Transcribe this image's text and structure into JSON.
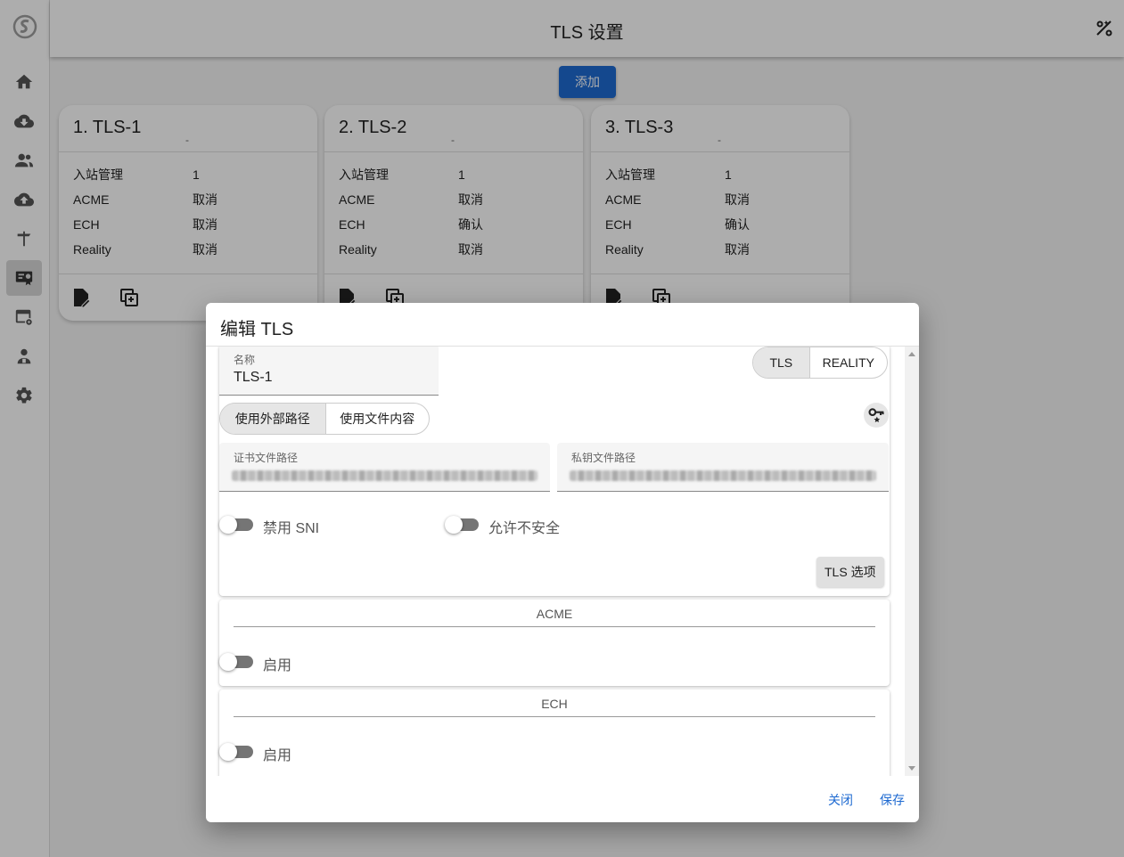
{
  "app": {
    "title": "TLS 设置"
  },
  "nav": [
    "home-icon",
    "download-icon",
    "users-icon",
    "upload-icon",
    "signpost-icon",
    "certificate-icon",
    "calendar-gear-icon",
    "admin-icon",
    "settings-icon"
  ],
  "toolbar": {
    "add_label": "添加"
  },
  "cards": [
    {
      "title": "1. TLS-1",
      "sub": "-",
      "rows": [
        {
          "k": "入站管理",
          "v": "1"
        },
        {
          "k": "ACME",
          "v": "取消"
        },
        {
          "k": "ECH",
          "v": "取消"
        },
        {
          "k": "Reality",
          "v": "取消"
        }
      ]
    },
    {
      "title": "2. TLS-2",
      "sub": "-",
      "rows": [
        {
          "k": "入站管理",
          "v": "1"
        },
        {
          "k": "ACME",
          "v": "取消"
        },
        {
          "k": "ECH",
          "v": "确认"
        },
        {
          "k": "Reality",
          "v": "取消"
        }
      ]
    },
    {
      "title": "3. TLS-3",
      "sub": "-",
      "rows": [
        {
          "k": "入站管理",
          "v": "1"
        },
        {
          "k": "ACME",
          "v": "取消"
        },
        {
          "k": "ECH",
          "v": "确认"
        },
        {
          "k": "Reality",
          "v": "取消"
        }
      ]
    }
  ],
  "dialog": {
    "title": "编辑 TLS",
    "name_label": "名称",
    "name_value": "TLS-1",
    "type_options": [
      "TLS",
      "REALITY"
    ],
    "type_selected": "TLS",
    "path_modes": [
      "使用外部路径",
      "使用文件内容"
    ],
    "path_selected": "使用外部路径",
    "cert_label": "证书文件路径",
    "key_label": "私钥文件路径",
    "disable_sni": "禁用 SNI",
    "allow_insecure": "允许不安全",
    "tls_options": "TLS 选项",
    "acme_title": "ACME",
    "acme_enable": "启用",
    "ech_title": "ECH",
    "ech_enable": "启用",
    "close": "关闭",
    "save": "保存"
  },
  "colors": {
    "primary": "#1e6ad1",
    "scrim": "rgba(0,0,0,0.32)"
  }
}
